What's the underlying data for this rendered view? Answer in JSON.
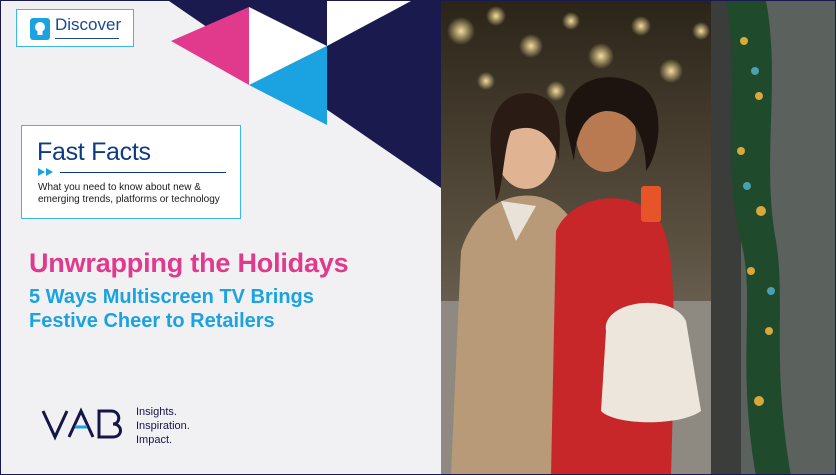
{
  "discover": {
    "label": "Discover",
    "icon": "lightbulb-icon"
  },
  "fast_facts": {
    "title": "Fast Facts",
    "description": "What you need to know about new & emerging trends, platforms or technology"
  },
  "headline": "Unwrapping the Holidays",
  "subheadline": [
    "5 Ways Multiscreen TV Brings",
    "Festive Cheer to Retailers"
  ],
  "logo": {
    "name": "VAB",
    "tagline": [
      "Insights.",
      "Inspiration.",
      "Impact."
    ]
  },
  "colors": {
    "navy": "#1a1a4e",
    "pink": "#e13a8d",
    "cyan": "#1aa3e0",
    "badge_border": "#3cb7e6",
    "title_blue": "#0f3b82"
  },
  "photo": {
    "subject": "two women looking at a phone by a decorated holiday shop window"
  }
}
